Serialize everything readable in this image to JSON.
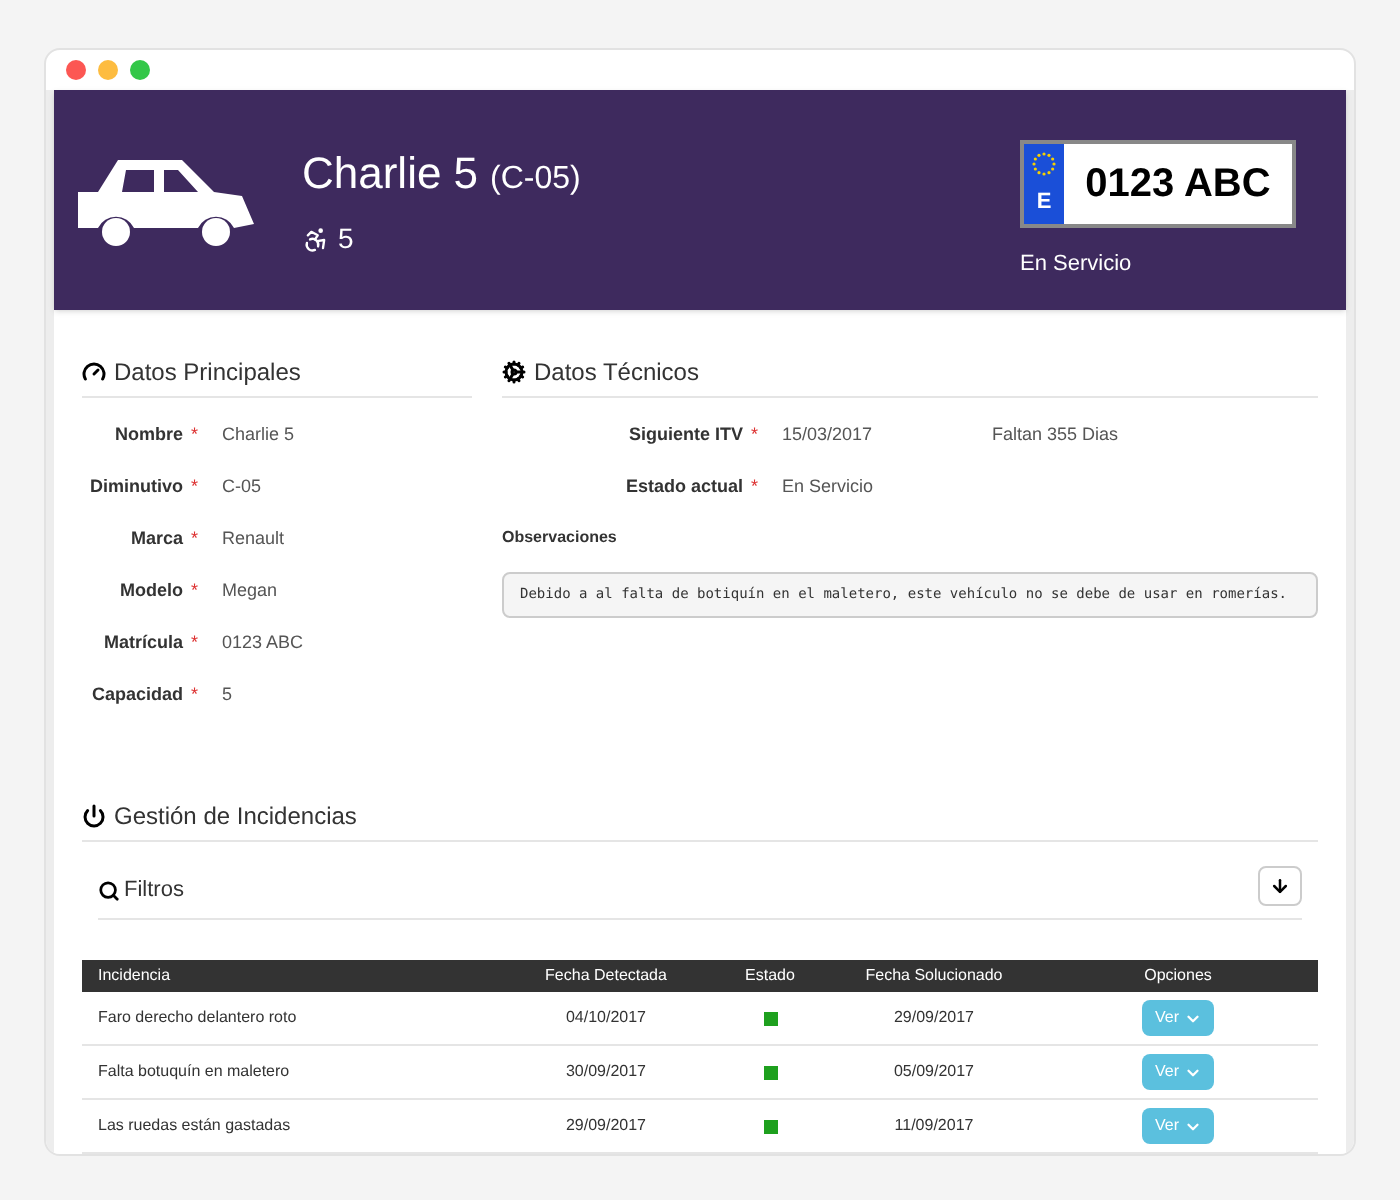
{
  "header": {
    "name": "Charlie 5",
    "short": "(C-05)",
    "seats": "5",
    "plate": {
      "country": "E",
      "number": "0123 ABC"
    },
    "status": "En Servicio"
  },
  "principal": {
    "title": "Datos Principales",
    "fields": [
      {
        "label": "Nombre",
        "value": "Charlie 5",
        "required_mark": "*"
      },
      {
        "label": "Diminutivo",
        "value": "C-05",
        "required_mark": "*"
      },
      {
        "label": "Marca",
        "value": "Renault",
        "required_mark": "*"
      },
      {
        "label": "Modelo",
        "value": "Megan",
        "required_mark": "*"
      },
      {
        "label": "Matrícula",
        "value": "0123 ABC",
        "required_mark": "*"
      },
      {
        "label": "Capacidad",
        "value": "5",
        "required_mark": "*"
      }
    ]
  },
  "tecnicos": {
    "title": "Datos Técnicos",
    "fields": [
      {
        "label": "Siguiente ITV",
        "value": "15/03/2017",
        "note": "Faltan 355 Dias",
        "required_mark": "*"
      },
      {
        "label": "Estado actual",
        "value": "En Servicio",
        "required_mark": "*"
      }
    ],
    "observations_label": "Observaciones",
    "observations": "Debido a al falta de botiquín en el maletero, este vehículo no se debe de usar en romerías."
  },
  "incidencias": {
    "title": "Gestión de Incidencias",
    "filters": "Filtros",
    "columns": [
      "Incidencia",
      "Fecha Detectada",
      "Estado",
      "Fecha Solucionado",
      "Opciones"
    ],
    "rows": [
      {
        "name": "Faro derecho delantero roto",
        "detected": "04/10/2017",
        "color": "#1ea01e",
        "solved": "29/09/2017",
        "action": "Ver"
      },
      {
        "name": "Falta botuquín en maletero",
        "detected": "30/09/2017",
        "color": "#1ea01e",
        "solved": "05/09/2017",
        "action": "Ver"
      },
      {
        "name": "Las ruedas están gastadas",
        "detected": "29/09/2017",
        "color": "#1ea01e",
        "solved": "11/09/2017",
        "action": "Ver"
      }
    ]
  }
}
